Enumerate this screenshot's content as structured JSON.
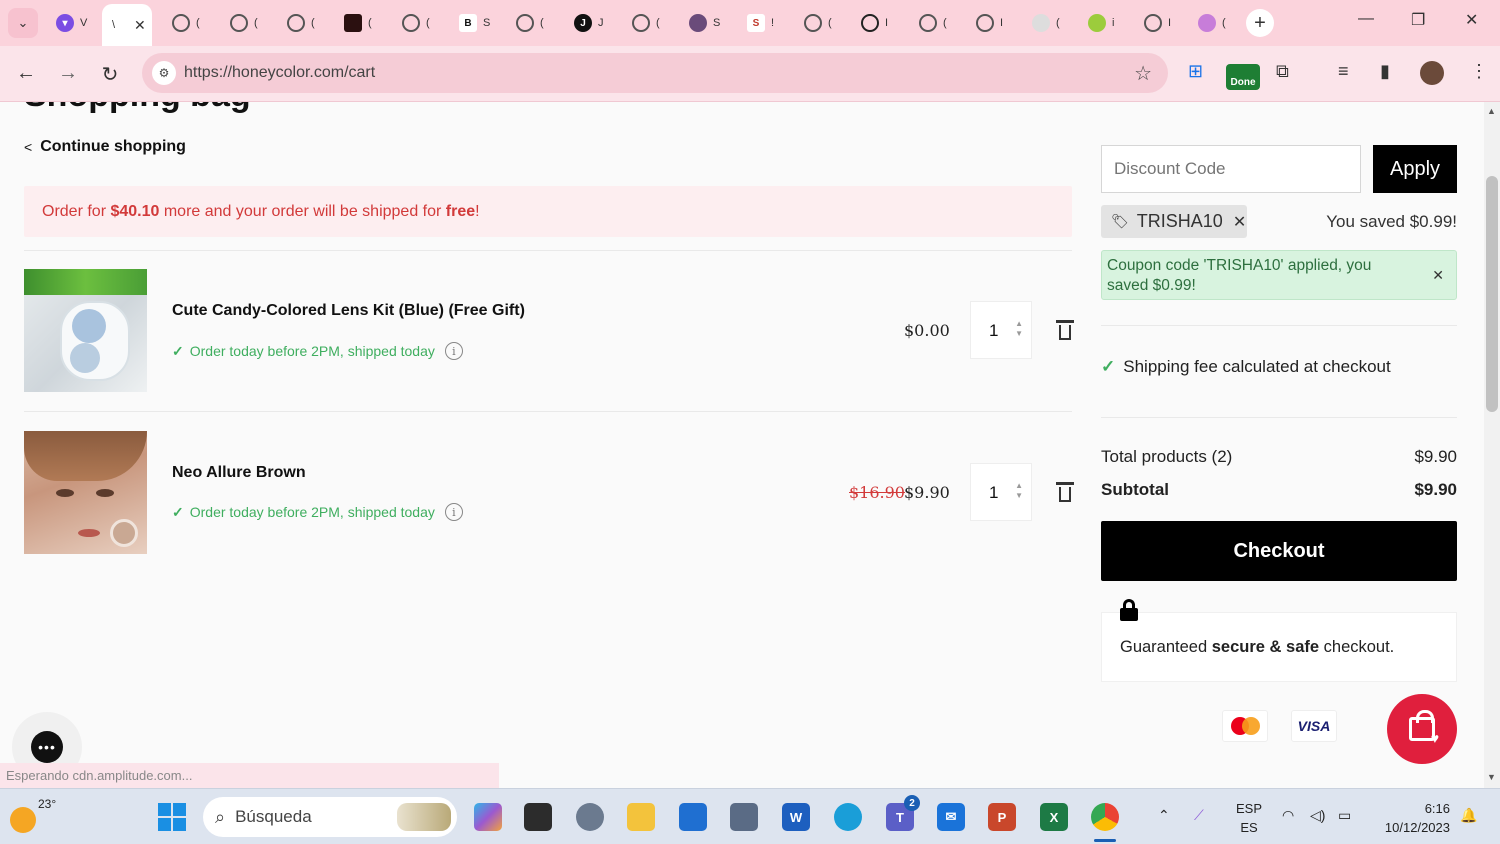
{
  "browser": {
    "active_tab_title": "\\",
    "url": "https://honeycolor.com/cart",
    "tabs": [
      {
        "icon": "purple-extension-icon",
        "title": "V"
      },
      {
        "icon": "globe-icon",
        "title": "("
      },
      {
        "icon": "globe-icon",
        "title": "("
      },
      {
        "icon": "globe-icon",
        "title": "("
      },
      {
        "icon": "dark-logo-icon",
        "title": "("
      },
      {
        "icon": "globe-icon",
        "title": "("
      },
      {
        "icon": "b-icon",
        "title": "S"
      },
      {
        "icon": "globe-icon",
        "title": "("
      },
      {
        "icon": "j-icon",
        "title": "J"
      },
      {
        "icon": "globe-icon",
        "title": "("
      },
      {
        "icon": "avatar-icon",
        "title": "S"
      },
      {
        "icon": "s-icon",
        "title": "!"
      },
      {
        "icon": "globe-icon",
        "title": "("
      },
      {
        "icon": "ring-icon",
        "title": "I"
      },
      {
        "icon": "globe-icon",
        "title": "("
      },
      {
        "icon": "globe-icon",
        "title": "I"
      },
      {
        "icon": "lens-icon",
        "title": "("
      },
      {
        "icon": "leaf-icon",
        "title": "i"
      },
      {
        "icon": "globe-icon",
        "title": "I"
      },
      {
        "icon": "pen-icon",
        "title": "("
      }
    ],
    "extension_done_label": "Done",
    "status_text": "Esperando cdn.amplitude.com..."
  },
  "page": {
    "title": "Shopping bag",
    "continue_label": "Continue shopping",
    "banner": {
      "prefix": "Order for ",
      "amount": "$40.10",
      "middle": " more and your order will be shipped for ",
      "free": "free",
      "suffix": "!"
    },
    "items": [
      {
        "name": "Cute Candy-Colored Lens Kit (Blue) (Free Gift)",
        "shipping": "Order today before 2PM, shipped today",
        "old_price": "",
        "price": "$0.00",
        "qty": "1"
      },
      {
        "name": "Neo Allure Brown",
        "shipping": "Order today before 2PM, shipped today",
        "old_price": "$16.90",
        "price": "$9.90",
        "qty": "1"
      }
    ]
  },
  "summary": {
    "discount_placeholder": "Discount Code",
    "apply_label": "Apply",
    "coupon_code": "TRISHA10",
    "saved_text": "You saved $0.99!",
    "coupon_alert": "Coupon code 'TRISHA10' applied, you saved $0.99!",
    "shipping_note": "Shipping fee calculated at checkout",
    "total_products_label": "Total products (2)",
    "total_products_value": "$9.90",
    "subtotal_label": "Subtotal",
    "subtotal_value": "$9.90",
    "checkout_label": "Checkout",
    "secure_prefix": "Guaranteed ",
    "secure_bold": "secure & safe",
    "secure_suffix": " checkout.",
    "payment_methods": [
      "Mastercard",
      "VISA"
    ]
  },
  "taskbar": {
    "temperature": "23°",
    "search_placeholder": "Búsqueda",
    "teams_badge": "2",
    "lang_line1": "ESP",
    "lang_line2": "ES",
    "time": "6:16",
    "date": "10/12/2023"
  },
  "colors": {
    "accent_red": "#d23a3a",
    "success_green": "#3fae5f",
    "brand_black": "#000000",
    "fab_red": "#e01f3d",
    "chrome_pink": "#fbd3dc"
  }
}
